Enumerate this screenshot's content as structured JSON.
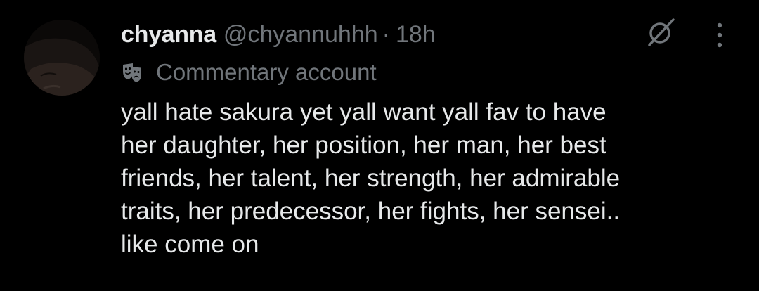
{
  "tweet": {
    "author": {
      "display_name": "chyanna",
      "handle": "@chyannuhhh",
      "avatar_icon": "avatar"
    },
    "separator": "·",
    "time": "18h",
    "label": {
      "icon": "masks-icon",
      "text": "Commentary account"
    },
    "text_lines": [
      "yall hate sakura yet yall want yall fav to have",
      "her daughter, her position, her man, her best",
      "friends, her talent, her strength, her admirable",
      "traits, her predecessor, her fights, her sensei..",
      "like come on"
    ],
    "actions": {
      "grok_icon": "grok-icon",
      "more_icon": "more-dots-icon"
    }
  },
  "colors": {
    "background": "#000000",
    "primary_text": "#e7e9ea",
    "secondary_text": "#71767b"
  }
}
